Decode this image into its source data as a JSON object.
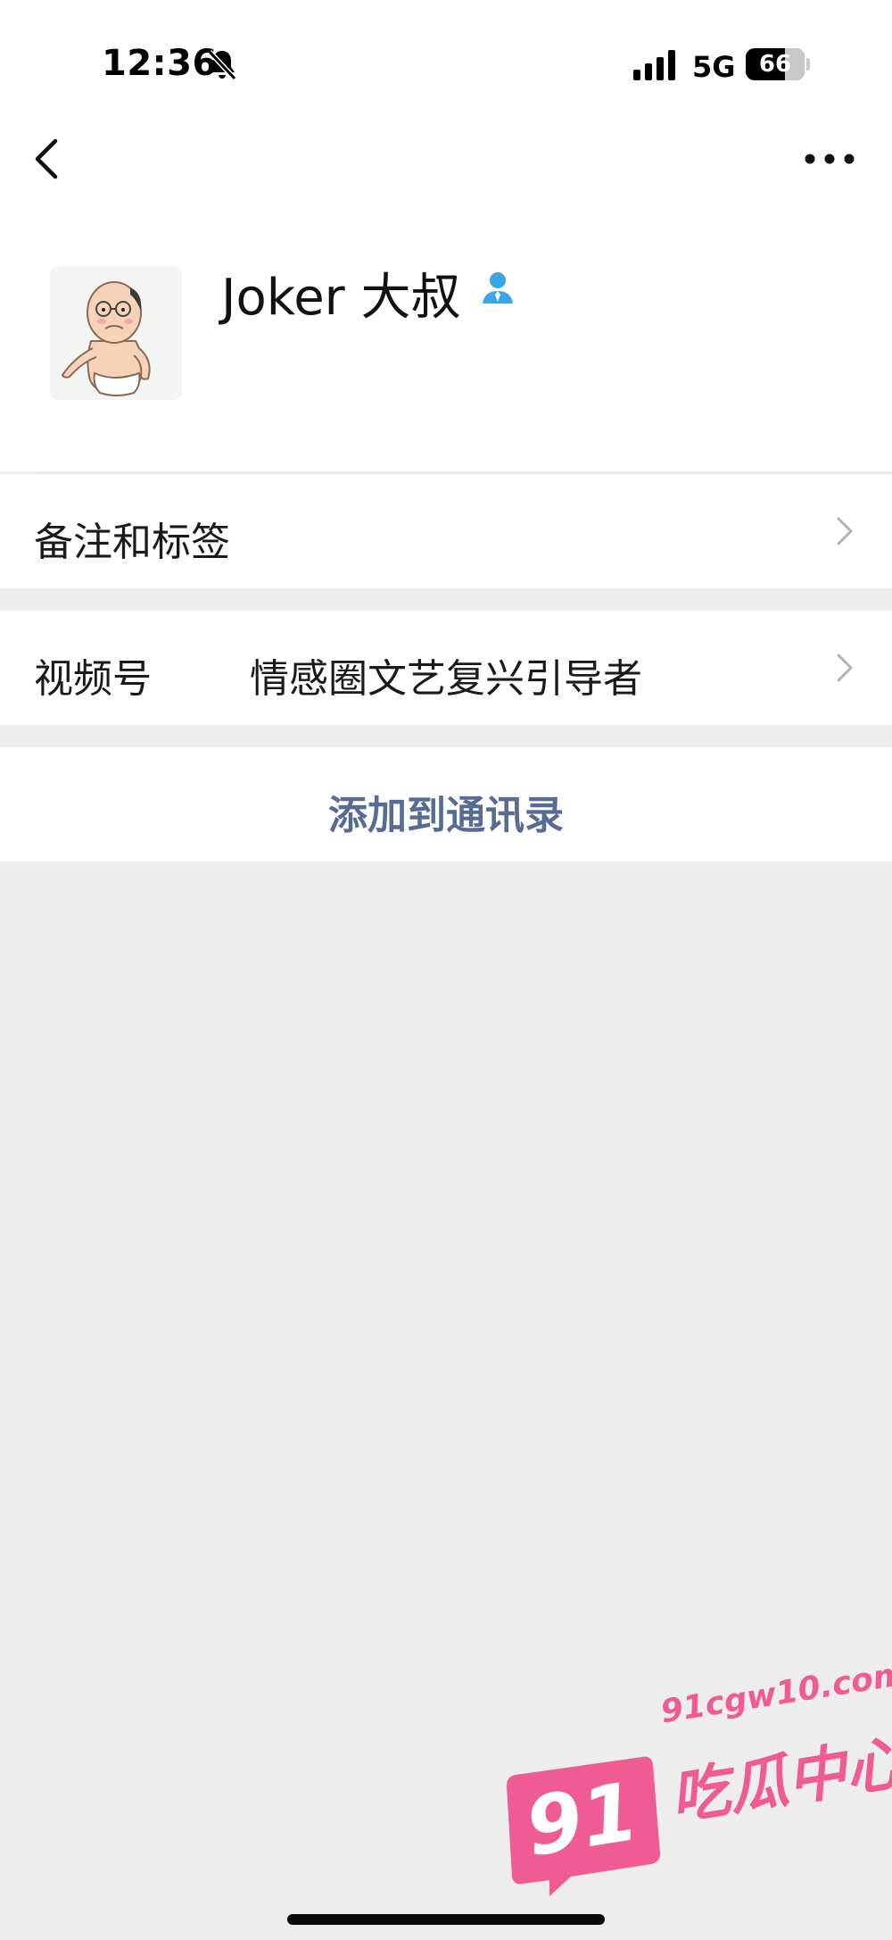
{
  "status_bar": {
    "time": "12:36",
    "network": "5G",
    "battery": "66"
  },
  "nav": {
    "back_icon": "chevron-left-icon",
    "more_icon": "ellipsis-icon"
  },
  "profile": {
    "name": "Joker 大叔",
    "gender_icon": "male-icon",
    "gender_color": "#3aa5e8"
  },
  "rows": {
    "remark_label": "备注和标签",
    "channel_label": "视频号",
    "channel_value": "情感圈文艺复兴引导者",
    "add_contact": "添加到通讯录"
  },
  "watermark": {
    "url": "91cgw10.com",
    "number": "91",
    "name": "吃瓜中心",
    "color": "#ef5b93"
  },
  "colors": {
    "link": "#576b95",
    "background": "#ededed"
  }
}
